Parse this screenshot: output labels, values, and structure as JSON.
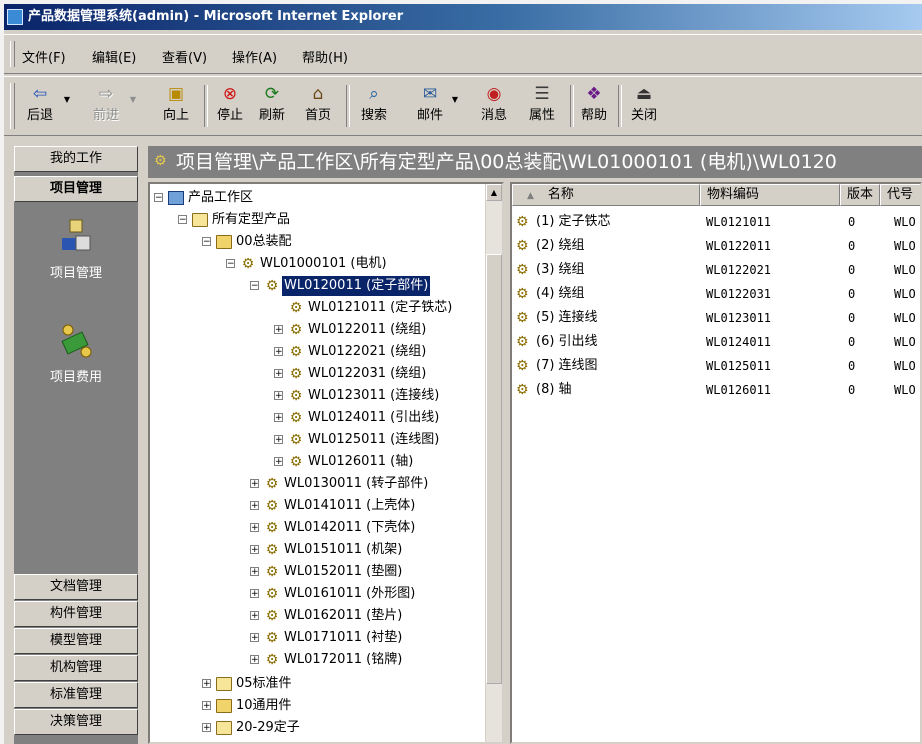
{
  "window": {
    "title": "产品数据管理系统(admin) - Microsoft Internet Explorer"
  },
  "menu": [
    "文件(F)",
    "编辑(E)",
    "查看(V)",
    "操作(A)",
    "帮助(H)"
  ],
  "toolbar": {
    "back": "后退",
    "forward": "前进",
    "up": "向上",
    "stop": "停止",
    "refresh": "刷新",
    "home": "首页",
    "search": "搜索",
    "mail": "邮件",
    "message": "消息",
    "properties": "属性",
    "help": "帮助",
    "close": "关闭"
  },
  "leftnav": {
    "my_work": "我的工作",
    "project_mgmt": "项目管理",
    "item_project_mgmt": "项目管理",
    "item_project_cost": "项目费用",
    "bottom": [
      "文档管理",
      "构件管理",
      "模型管理",
      "机构管理",
      "标准管理",
      "决策管理"
    ]
  },
  "path": "项目管理\\产品工作区\\所有定型产品\\00总装配\\WL01000101 (电机)\\WL0120",
  "tree": {
    "root": "产品工作区",
    "all_products": "所有定型产品",
    "assembly": "00总装配",
    "motor": "WL01000101 (电机)",
    "selected": "WL0120011 (定子部件)",
    "children": [
      "WL0121011 (定子铁芯)",
      "WL0122011 (绕组)",
      "WL0122021 (绕组)",
      "WL0122031 (绕组)",
      "WL0123011 (连接线)",
      "WL0124011 (引出线)",
      "WL0125011 (连线图)",
      "WL0126011 (轴)"
    ],
    "siblings": [
      "WL0130011 (转子部件)",
      "WL0141011 (上壳体)",
      "WL0142011 (下壳体)",
      "WL0151011 (机架)",
      "WL0152011 (垫圈)",
      "WL0161011 (外形图)",
      "WL0162011 (垫片)",
      "WL0171011 (衬垫)",
      "WL0172011 (铭牌)"
    ],
    "folders": [
      "05标准件",
      "10通用件",
      "20-29定子"
    ]
  },
  "list": {
    "headers": {
      "name": "名称",
      "code": "物料编码",
      "version": "版本",
      "other": "代号"
    },
    "rows": [
      {
        "name": "(1) 定子铁芯",
        "code": "WL0121011",
        "version": "0",
        "other": "WLO"
      },
      {
        "name": "(2) 绕组",
        "code": "WL0122011",
        "version": "0",
        "other": "WLO"
      },
      {
        "name": "(3) 绕组",
        "code": "WL0122021",
        "version": "0",
        "other": "WLO"
      },
      {
        "name": "(4) 绕组",
        "code": "WL0122031",
        "version": "0",
        "other": "WLO"
      },
      {
        "name": "(5) 连接线",
        "code": "WL0123011",
        "version": "0",
        "other": "WLO"
      },
      {
        "name": "(6) 引出线",
        "code": "WL0124011",
        "version": "0",
        "other": "WLO"
      },
      {
        "name": "(7) 连线图",
        "code": "WL0125011",
        "version": "0",
        "other": "WLO"
      },
      {
        "name": "(8) 轴",
        "code": "WL0126011",
        "version": "0",
        "other": "WLO"
      }
    ]
  },
  "colors": {
    "selection": "#0a246a",
    "titlebar": "#0a246a",
    "chrome": "#d4d0c8",
    "nav_bg": "#808080"
  }
}
